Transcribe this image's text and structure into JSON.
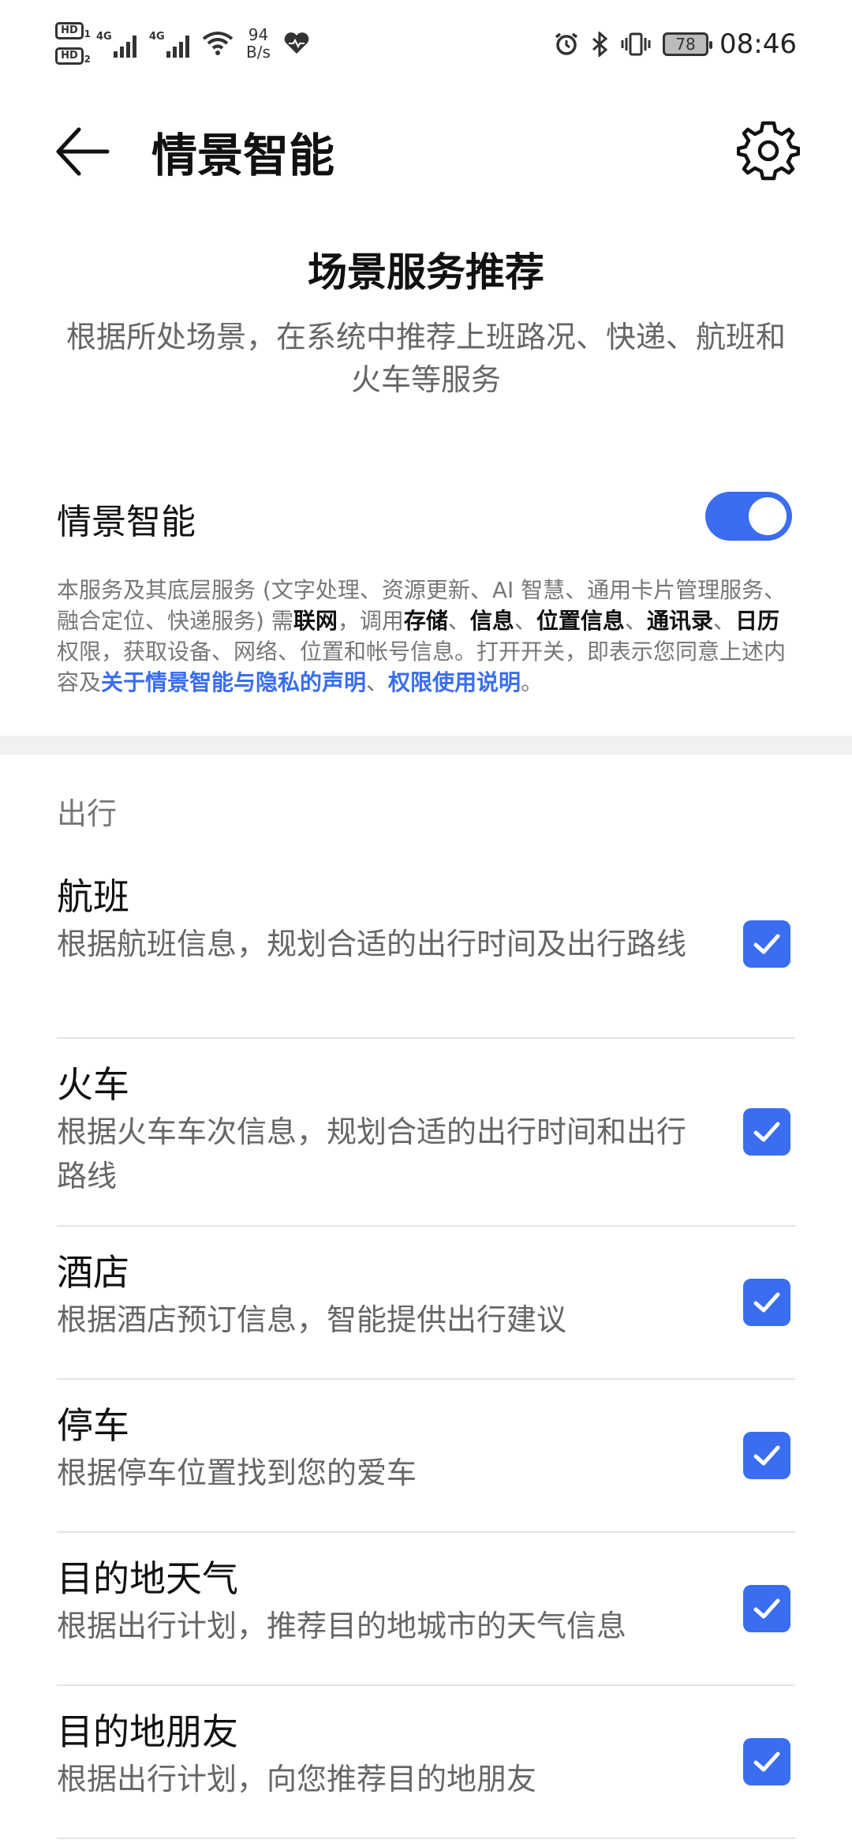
{
  "status_bar": {
    "hd1": "HD",
    "hd1_sub": "1",
    "hd2": "HD",
    "hd2_sub": "2",
    "net1": "4G",
    "net2": "4G",
    "speed_value": "94",
    "speed_unit": "B/s",
    "battery": "78",
    "time": "08:46"
  },
  "topbar": {
    "title": "情景智能"
  },
  "hero": {
    "title": "场景服务推荐",
    "description": "根据所处场景，在系统中推荐上班路况、快递、航班和火车等服务"
  },
  "main_toggle": {
    "label": "情景智能",
    "on": true
  },
  "notice": {
    "p1": "本服务及其底层服务 (文字处理、资源更新、AI 智慧、通用卡片管理服务、融合定位、快递服务) 需",
    "b1": "联网",
    "p2": "，调用",
    "b2": "存储",
    "p3": "、",
    "b3": "信息",
    "p4": "、",
    "b4": "位置信息",
    "p5": "、",
    "b5": "通讯录",
    "p6": "、",
    "b6": "日历",
    "p7": "权限，获取设备、网络、位置和帐号信息。打开开关，即表示您同意上述内容及",
    "link1": "关于情景智能与隐私的声明",
    "p8": "、",
    "link2": "权限使用说明",
    "p9": "。"
  },
  "section": {
    "title": "出行"
  },
  "items": [
    {
      "title": "航班",
      "desc": "根据航班信息，规划合适的出行时间及出行路线",
      "checked": true
    },
    {
      "title": "火车",
      "desc": "根据火车车次信息，规划合适的出行时间和出行路线",
      "checked": true
    },
    {
      "title": "酒店",
      "desc": "根据酒店预订信息，智能提供出行建议",
      "checked": true
    },
    {
      "title": "停车",
      "desc": "根据停车位置找到您的爱车",
      "checked": true
    },
    {
      "title": "目的地天气",
      "desc": "根据出行计划，推荐目的地城市的天气信息",
      "checked": true
    },
    {
      "title": "目的地朋友",
      "desc": "根据出行计划，向您推荐目的地朋友",
      "checked": true
    }
  ],
  "colors": {
    "accent": "#3a6df0",
    "divider": "#e4e4e4"
  }
}
